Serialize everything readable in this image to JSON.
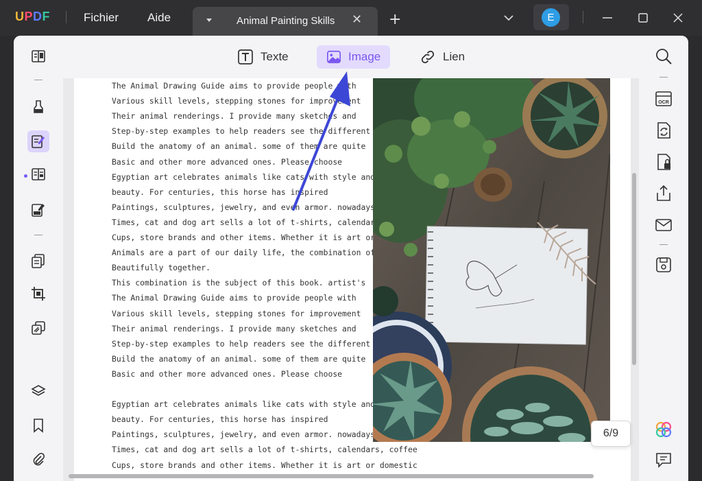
{
  "app": {
    "logo": {
      "u": "U",
      "p": "P",
      "d": "D",
      "f": "F"
    },
    "menu": [
      "Fichier",
      "Aide"
    ],
    "tab_title": "Animal Painting Skills",
    "tab_close": "✕",
    "add_tab": "+",
    "avatar_letter": "E"
  },
  "toolbar": {
    "texte": "Texte",
    "image": "Image",
    "lien": "Lien"
  },
  "document": {
    "lines": [
      "The Animal Drawing Guide aims to provide people with",
      "Various skill levels, stepping stones for improvement",
      "Their animal renderings. I provide many sketches and",
      "Step-by-step examples to help readers see the different ways",
      "Build the anatomy of an animal. some of them are quite",
      "Basic and other more advanced ones. Please choose",
      "Egyptian art celebrates animals like cats with style and style",
      "beauty. For centuries, this horse has inspired",
      "Paintings, sculptures, jewelry, and even armor. nowadays",
      "Times, cat and dog art sells a lot of t-shirts, calendars, coffee",
      "Cups, store brands and other items. Whether it is art or domestic",
      "Animals are a part of our daily life, the combination of the two",
      "Beautifully together.",
      "This combination is the subject of this book. artist's",
      "The Animal Drawing Guide aims to provide people with",
      "Various skill levels, stepping stones for improvement",
      "Their animal renderings. I provide many sketches and",
      "Step-by-step examples to help readers see the different ways",
      "Build the anatomy of an animal. some of them are quite",
      "Basic and other more advanced ones. Please choose",
      "",
      "Egyptian art celebrates animals like cats with style and style",
      "beauty. For centuries, this horse has inspired",
      "Paintings, sculptures, jewelry, and even armor. nowadays",
      "Times, cat and dog art sells a lot of t-shirts, calendars, coffee",
      "Cups, store brands and other items. Whether it is art or domestic"
    ],
    "page_indicator": "6/9"
  },
  "colors": {
    "accent": "#7a56f0",
    "arrow": "#3d47d6",
    "avatar": "#2e9de5"
  }
}
